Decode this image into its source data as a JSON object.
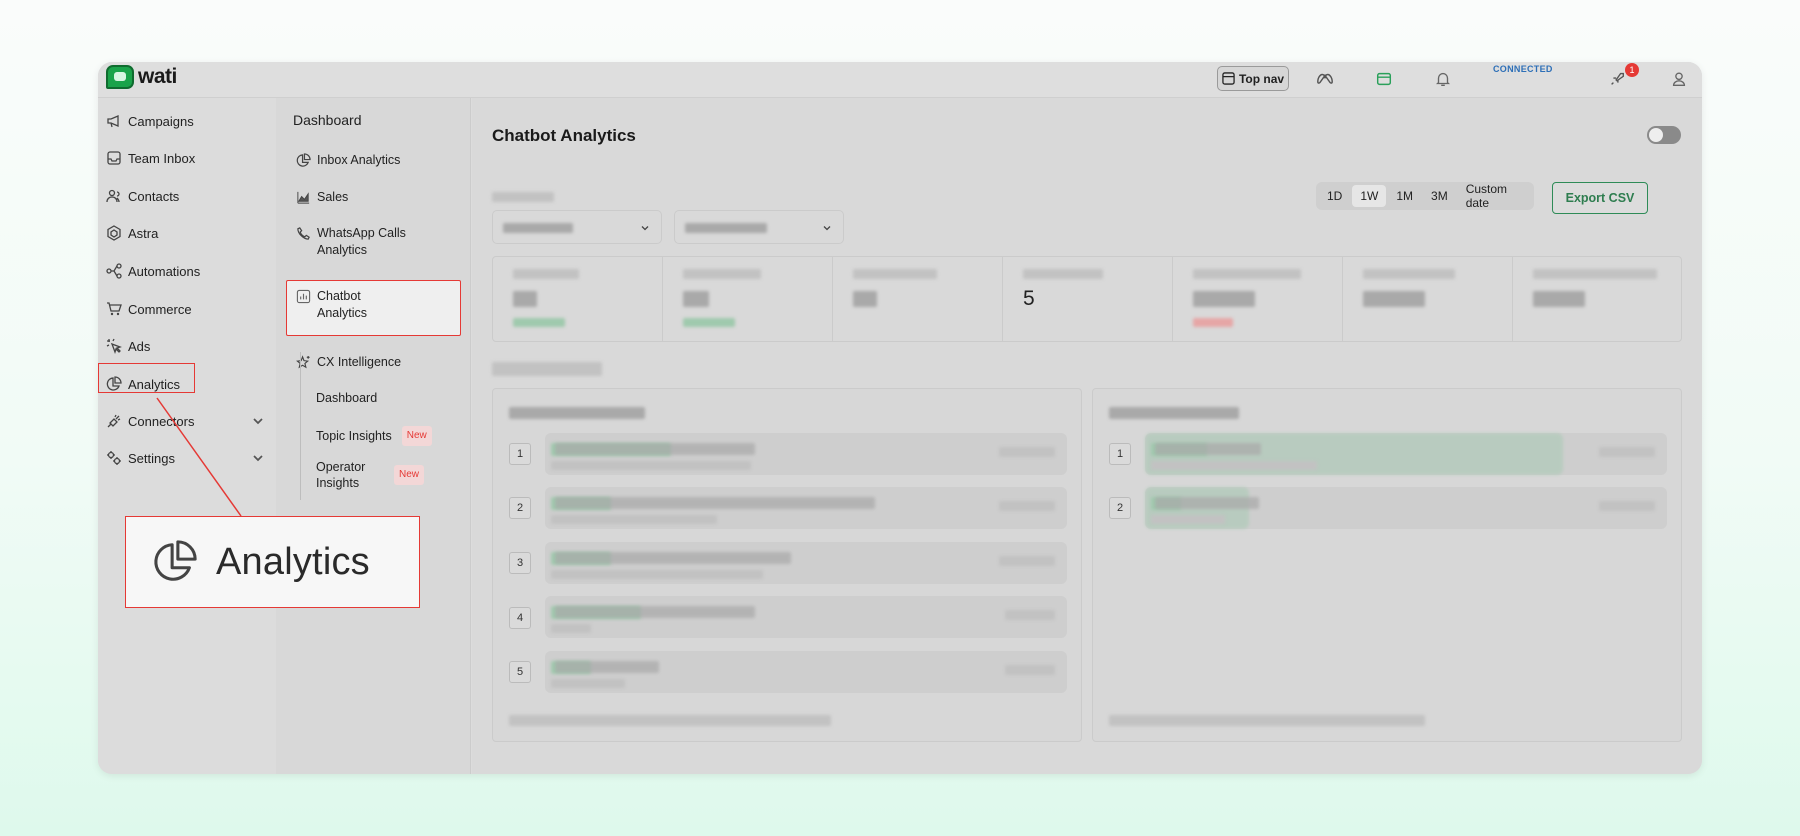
{
  "app": {
    "logo_text": "wati"
  },
  "topbar": {
    "top_nav_label": "Top nav",
    "connected_label": "CONNECTED",
    "notification_count": "1"
  },
  "sidebar": {
    "items": [
      {
        "label": "Campaigns",
        "icon": "megaphone-icon"
      },
      {
        "label": "Team Inbox",
        "icon": "inbox-icon"
      },
      {
        "label": "Contacts",
        "icon": "contacts-icon"
      },
      {
        "label": "Astra",
        "icon": "astra-icon"
      },
      {
        "label": "Automations",
        "icon": "automations-icon"
      },
      {
        "label": "Commerce",
        "icon": "cart-icon"
      },
      {
        "label": "Ads",
        "icon": "ads-icon"
      },
      {
        "label": "Analytics",
        "icon": "pie-chart-icon"
      },
      {
        "label": "Connectors",
        "icon": "plug-icon"
      },
      {
        "label": "Settings",
        "icon": "gear-icon"
      }
    ]
  },
  "subnav": {
    "title": "Dashboard",
    "items": [
      {
        "label": "Inbox Analytics"
      },
      {
        "label": "Sales"
      },
      {
        "label": "WhatsApp Calls Analytics"
      },
      {
        "label": "Chatbot Analytics"
      },
      {
        "label": "CX Intelligence"
      }
    ],
    "cx_children": [
      {
        "label": "Dashboard",
        "badge": ""
      },
      {
        "label": "Topic Insights",
        "badge": "New"
      },
      {
        "label": "Operator Insights",
        "badge": "New"
      }
    ]
  },
  "main": {
    "title": "Chatbot Analytics",
    "ranges": [
      "1D",
      "1W",
      "1M",
      "3M",
      "Custom date"
    ],
    "selected_range": "1W",
    "export_label": "Export CSV",
    "visible_stat_value": "5",
    "left_rank_numbers": [
      "1",
      "2",
      "3",
      "4",
      "5"
    ],
    "right_rank_numbers": [
      "1",
      "2"
    ]
  },
  "callout": {
    "label": "Analytics"
  },
  "colors": {
    "accent": "#1aa34a",
    "highlight": "#e53935"
  }
}
